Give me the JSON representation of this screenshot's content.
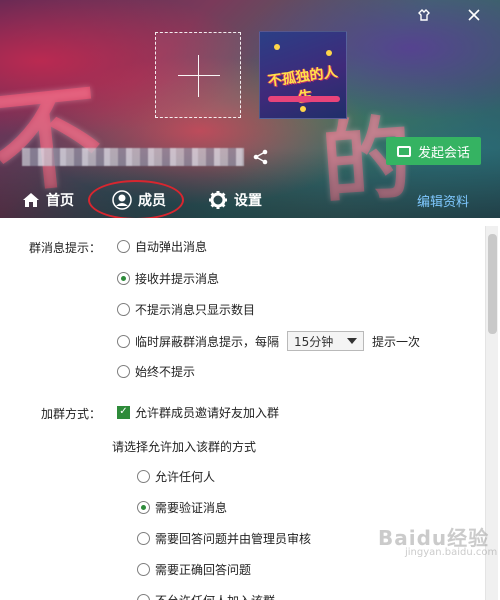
{
  "header": {
    "group_name": "",
    "bg_text_left": "不",
    "bg_text_right": "的人生",
    "avatar_text": "不孤独的人生",
    "actions": {
      "start_chat": "发起会话"
    },
    "tabs": [
      {
        "label": "首页"
      },
      {
        "label": "成员"
      },
      {
        "label": "设置"
      }
    ],
    "edit_profile": "编辑资料",
    "accent_color": "#35b362",
    "highlight_color": "#d8262f"
  },
  "settings": {
    "message_prompt": {
      "label": "群消息提示：",
      "options": [
        {
          "text": "自动弹出消息",
          "checked": false
        },
        {
          "text": "接收并提示消息",
          "checked": true
        },
        {
          "text": "不提示消息只显示数目",
          "checked": false
        },
        {
          "text": "临时屏蔽群消息提示，每隔",
          "checked": false
        },
        {
          "text": "始终不提示",
          "checked": false
        }
      ],
      "interval_value": "15分钟",
      "interval_suffix": "提示一次"
    },
    "join_group": {
      "label": "加群方式：",
      "allow_invite": {
        "text": "允许群成员邀请好友加入群",
        "checked": true
      },
      "choose_label": "请选择允许加入该群的方式",
      "options": [
        {
          "text": "允许任何人",
          "checked": false
        },
        {
          "text": "需要验证消息",
          "checked": true
        },
        {
          "text": "需要回答问题并由管理员审核",
          "checked": false
        },
        {
          "text": "需要正确回答问题",
          "checked": false
        },
        {
          "text": "不允许任何人加入该群",
          "checked": false
        }
      ]
    }
  },
  "watermark": {
    "main": "Baidu经验",
    "sub": "jingyan.baidu.com"
  }
}
